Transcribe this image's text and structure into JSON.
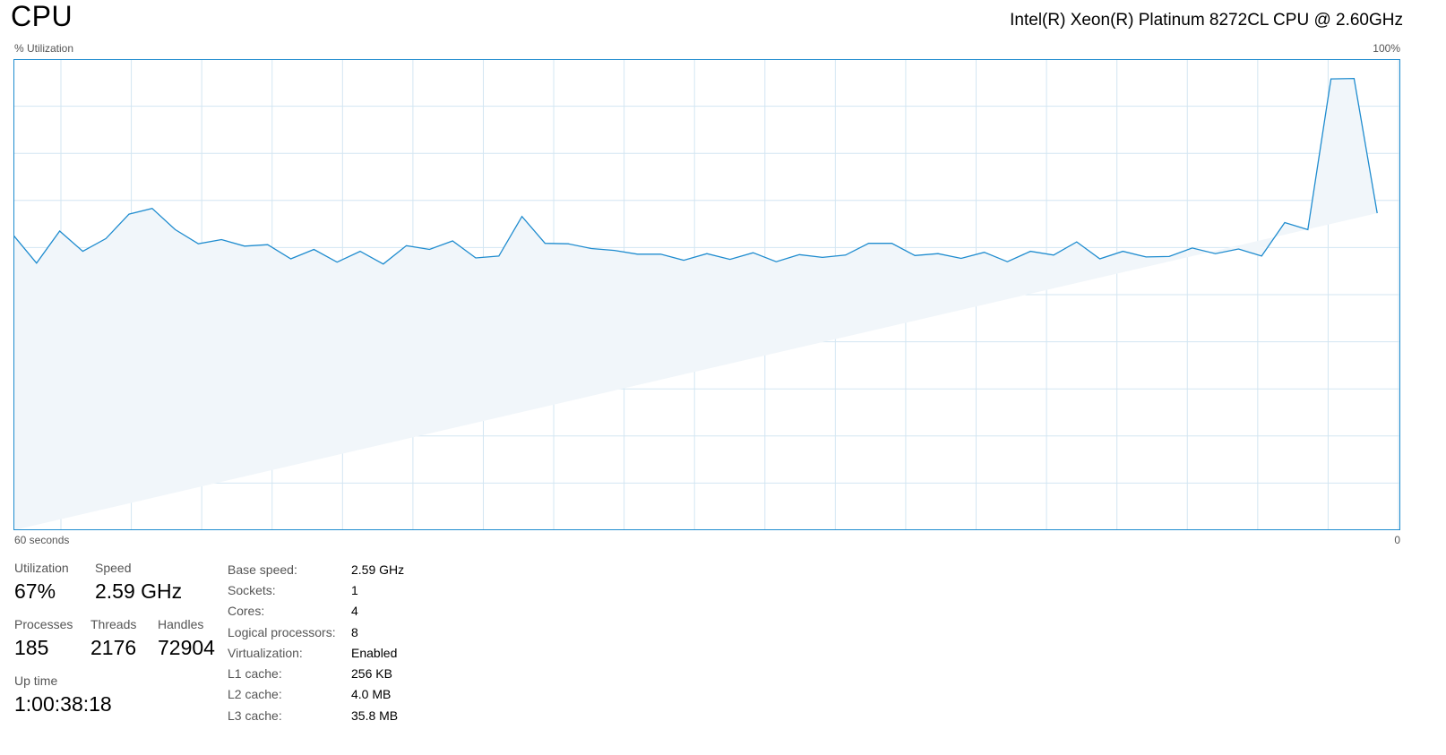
{
  "header": {
    "title": "CPU",
    "cpu_model": "Intel(R) Xeon(R) Platinum 8272CL CPU @ 2.60GHz"
  },
  "graph": {
    "utilization_label": "% Utilization",
    "max_label": "100%",
    "time_span_label": "60 seconds",
    "min_label": "0",
    "line_color": "#1f8ccf",
    "fill_color": "#f1f6fa",
    "grid_color": "#d3e6f2",
    "border_color": "#1f8ccf"
  },
  "chart_data": {
    "type": "area",
    "x": [
      60,
      59,
      58,
      57,
      56,
      55,
      54,
      53,
      52,
      51,
      50,
      49,
      48,
      47,
      46,
      45,
      44,
      43,
      42,
      41,
      40,
      39,
      38,
      37,
      36,
      35,
      34,
      33,
      32,
      31,
      30,
      29,
      28,
      27,
      26,
      25,
      24,
      23,
      22,
      21,
      20,
      19,
      18,
      17,
      16,
      15,
      14,
      13,
      12,
      11,
      10,
      9,
      8,
      7,
      6,
      5,
      4,
      3,
      2,
      1,
      0
    ],
    "values": [
      62.6,
      56.7,
      63.5,
      59.2,
      61.9,
      67.1,
      68.3,
      63.8,
      60.8,
      61.7,
      60.3,
      60.6,
      57.6,
      59.6,
      56.9,
      59.2,
      56.5,
      60.4,
      59.6,
      61.4,
      57.8,
      58.2,
      66.6,
      60.9,
      60.8,
      59.8,
      59.4,
      58.6,
      58.6,
      57.3,
      58.7,
      57.5,
      58.9,
      57.0,
      58.5,
      57.9,
      58.4,
      60.9,
      60.9,
      58.3,
      58.7,
      57.7,
      59.0,
      57.0,
      59.2,
      58.4,
      61.2,
      57.6,
      59.2,
      58.0,
      58.1,
      59.9,
      58.7,
      59.7,
      58.2,
      65.3,
      63.8,
      95.8,
      95.9,
      67.3
    ],
    "xlim": [
      60,
      0
    ],
    "ylim": [
      0,
      100
    ],
    "grid": true
  },
  "stats": {
    "utilization": {
      "label": "Utilization",
      "value": "67%"
    },
    "speed": {
      "label": "Speed",
      "value": "2.59 GHz"
    },
    "processes": {
      "label": "Processes",
      "value": "185"
    },
    "threads": {
      "label": "Threads",
      "value": "2176"
    },
    "handles": {
      "label": "Handles",
      "value": "72904"
    },
    "uptime": {
      "label": "Up time",
      "value": "1:00:38:18"
    }
  },
  "details": [
    {
      "key": "Base speed:",
      "value": "2.59 GHz"
    },
    {
      "key": "Sockets:",
      "value": "1"
    },
    {
      "key": "Cores:",
      "value": "4"
    },
    {
      "key": "Logical processors:",
      "value": "8"
    },
    {
      "key": "Virtualization:",
      "value": "Enabled"
    },
    {
      "key": "L1 cache:",
      "value": "256 KB"
    },
    {
      "key": "L2 cache:",
      "value": "4.0 MB"
    },
    {
      "key": "L3 cache:",
      "value": "35.8 MB"
    }
  ]
}
